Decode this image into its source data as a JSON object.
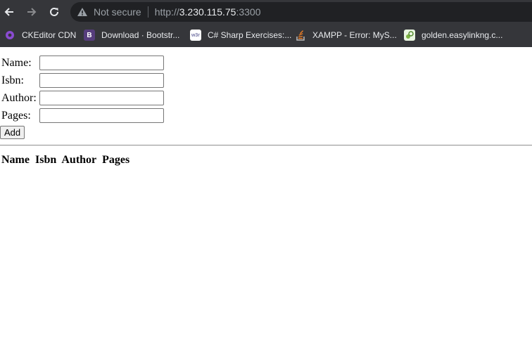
{
  "browser": {
    "security_label": "Not secure",
    "url": {
      "scheme": "http://",
      "host": "3.230.115.75",
      "port": ":3300"
    },
    "bookmarks": [
      {
        "label": "CKEditor CDN",
        "icon": "ckeditor-icon"
      },
      {
        "label": "Download · Bootstr...",
        "icon": "bootstrap-icon"
      },
      {
        "label": "C# Sharp Exercises:...",
        "icon": "w3r-icon"
      },
      {
        "label": "XAMPP - Error: MyS...",
        "icon": "stackoverflow-icon"
      },
      {
        "label": "golden.easylinkng.c...",
        "icon": "site-icon"
      }
    ]
  },
  "form": {
    "name_label": "Name:",
    "isbn_label": "Isbn:",
    "author_label": "Author:",
    "pages_label": "Pages:",
    "name_value": "",
    "isbn_value": "",
    "author_value": "",
    "pages_value": "",
    "add_label": "Add"
  },
  "table": {
    "headers": [
      "Name",
      "Isbn",
      "Author",
      "Pages"
    ]
  }
}
